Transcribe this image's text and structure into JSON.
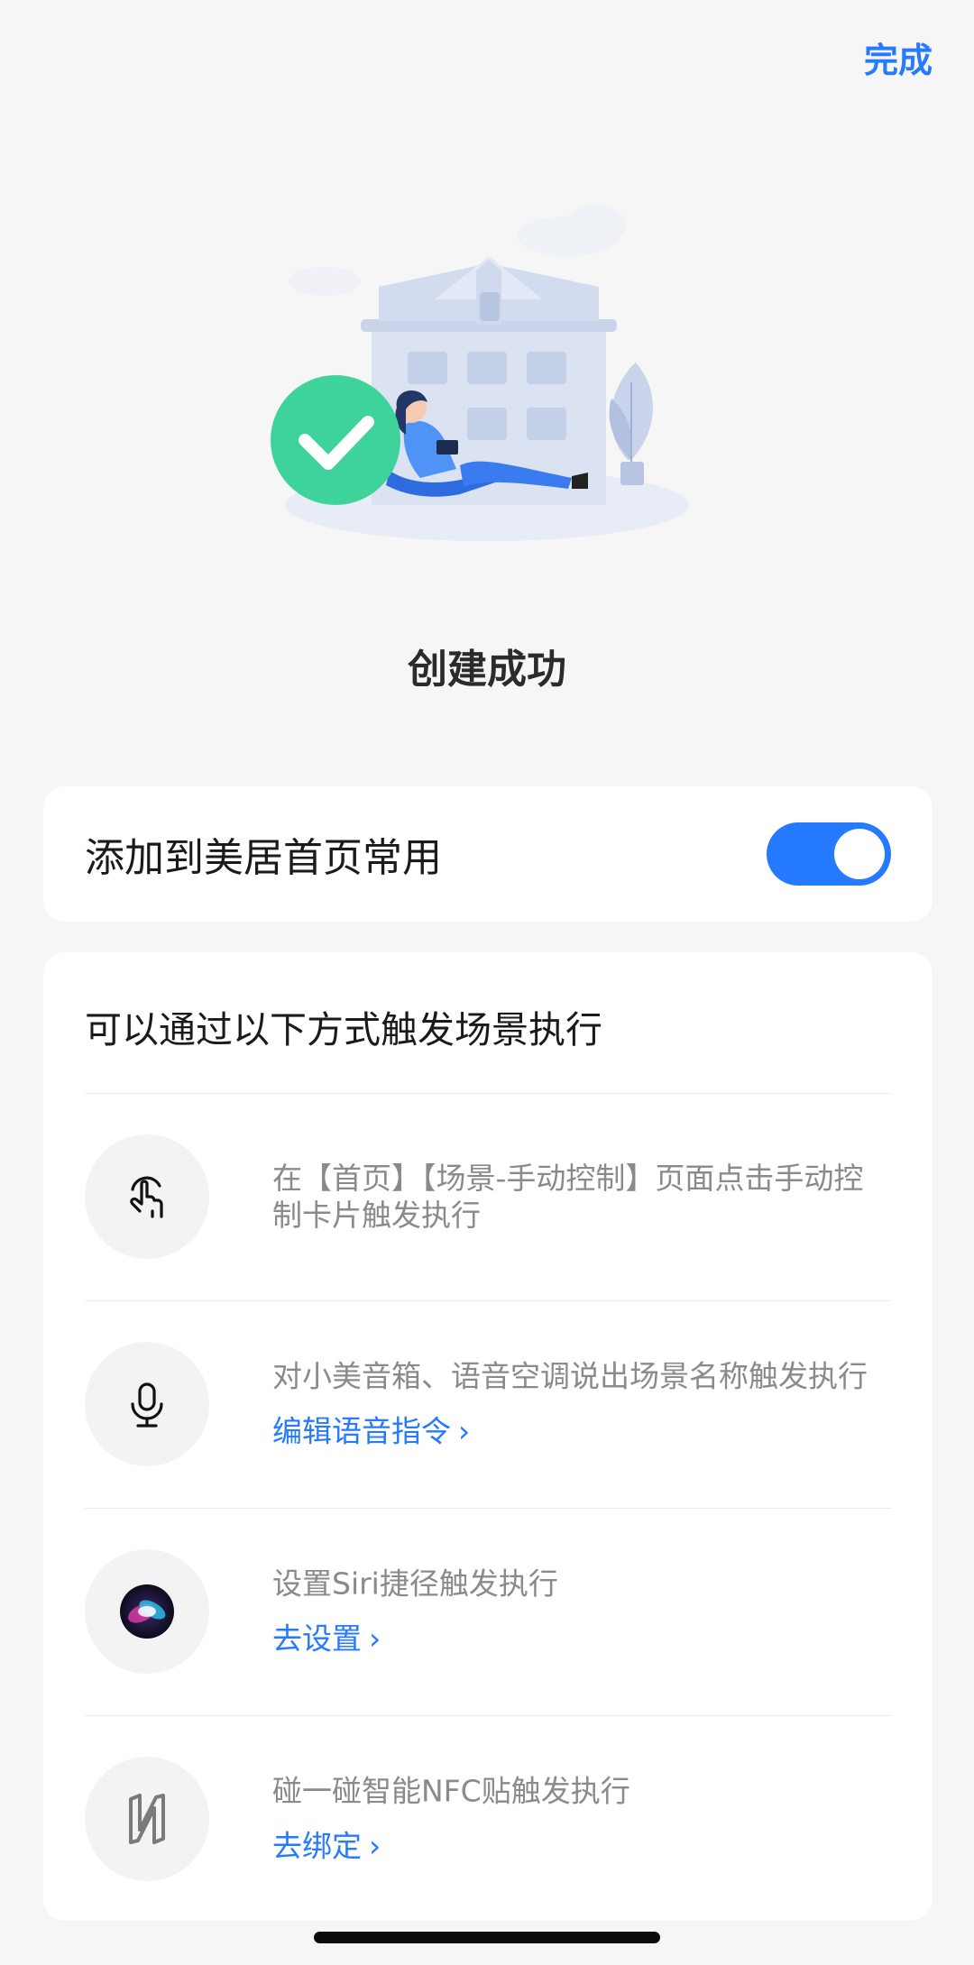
{
  "header": {
    "done_label": "完成"
  },
  "status": {
    "title": "创建成功"
  },
  "favorite": {
    "label": "添加到美居首页常用",
    "enabled": true
  },
  "methods": {
    "title": "可以通过以下方式触发场景执行",
    "items": [
      {
        "icon": "tap-hand-icon",
        "desc": "在【首页】【场景-手动控制】页面点击手动控制卡片触发执行",
        "link": ""
      },
      {
        "icon": "microphone-icon",
        "desc": "对小美音箱、语音空调说出场景名称触发执行",
        "link": "编辑语音指令"
      },
      {
        "icon": "siri-icon",
        "desc": "设置Siri捷径触发执行",
        "link": "去设置"
      },
      {
        "icon": "nfc-icon",
        "desc": "碰一碰智能NFC贴触发执行",
        "link": "去绑定"
      }
    ]
  },
  "colors": {
    "accent": "#267aff",
    "success": "#3ed39b",
    "background": "#f6f6f6"
  }
}
